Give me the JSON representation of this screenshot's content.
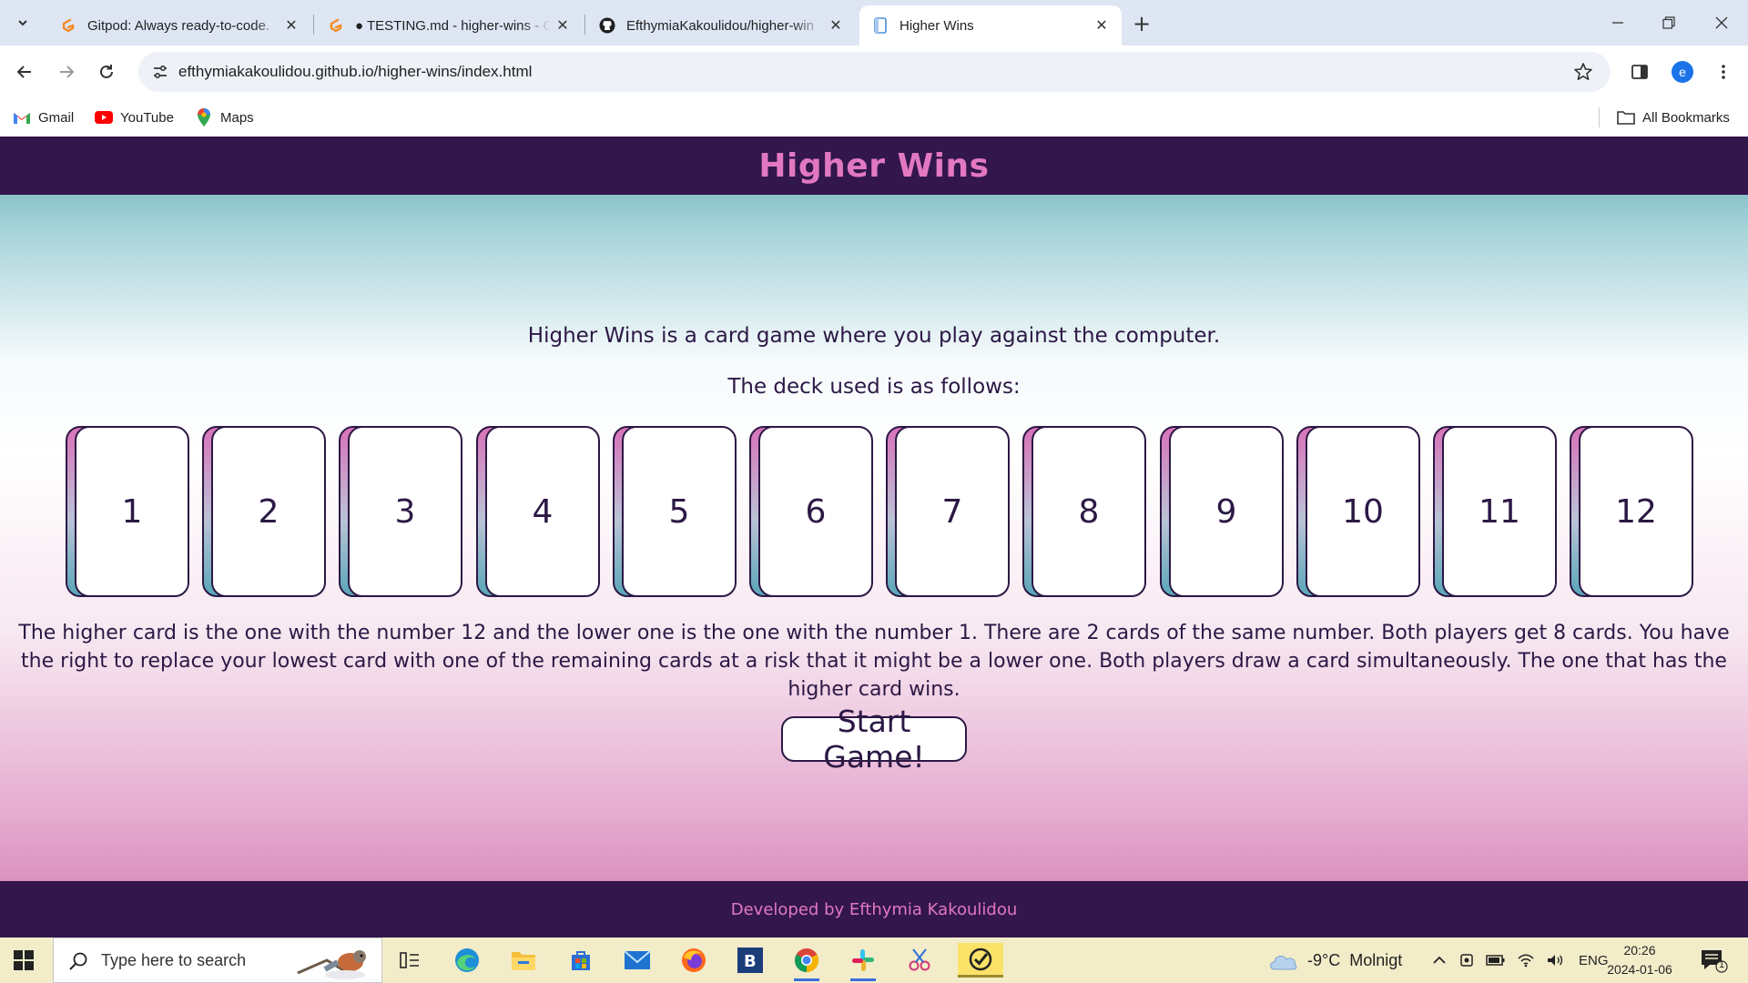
{
  "browser": {
    "tabs": [
      {
        "title": "Gitpod: Always ready-to-code.",
        "favicon": "gitpod-icon",
        "active": false
      },
      {
        "title": "● TESTING.md - higher-wins - G",
        "favicon": "gitpod-icon",
        "active": false
      },
      {
        "title": "EfthymiaKakoulidou/higher-win",
        "favicon": "github-icon",
        "active": false
      },
      {
        "title": "Higher Wins",
        "favicon": "page-icon",
        "active": true
      }
    ],
    "url": "efthymiakakoulidou.github.io/higher-wins/index.html",
    "profile_initial": "e",
    "bookmarks": [
      {
        "label": "Gmail",
        "icon": "gmail-icon"
      },
      {
        "label": "YouTube",
        "icon": "youtube-icon"
      },
      {
        "label": "Maps",
        "icon": "maps-icon"
      }
    ],
    "all_bookmarks_label": "All Bookmarks"
  },
  "page": {
    "title": "Higher Wins",
    "intro_line1": "Higher Wins is a card game where you play against the computer.",
    "intro_line2": "The deck used is as follows:",
    "cards": [
      "1",
      "2",
      "3",
      "4",
      "5",
      "6",
      "7",
      "8",
      "9",
      "10",
      "11",
      "12"
    ],
    "rules": "The higher card is the one with the number 12 and the lower one is the one with the number 1. There are 2 cards of the same number. Both players get 8 cards. You have the right to replace your lowest card with one of the remaining cards at a risk that it might be a lower one. Both players draw a card simultaneously. The one that has the higher card wins.",
    "start_button": "Start Game!",
    "footer": "Developed by Efthymia Kakoulidou",
    "colors": {
      "header_bg": "#32164c",
      "accent_pink": "#e278c1",
      "text_dark": "#2c1845"
    }
  },
  "taskbar": {
    "search_placeholder": "Type here to search",
    "apps": [
      "task-view-icon",
      "edge-icon",
      "file-explorer-icon",
      "store-icon",
      "mail-icon",
      "firefox-icon",
      "b-app-icon",
      "chrome-icon",
      "slack-icon",
      "snipping-icon",
      "norton-icon"
    ],
    "weather": "-9°C  Molnigt",
    "language": "ENG",
    "time": "20:26",
    "date": "2024-01-06",
    "notification_count": "1"
  }
}
